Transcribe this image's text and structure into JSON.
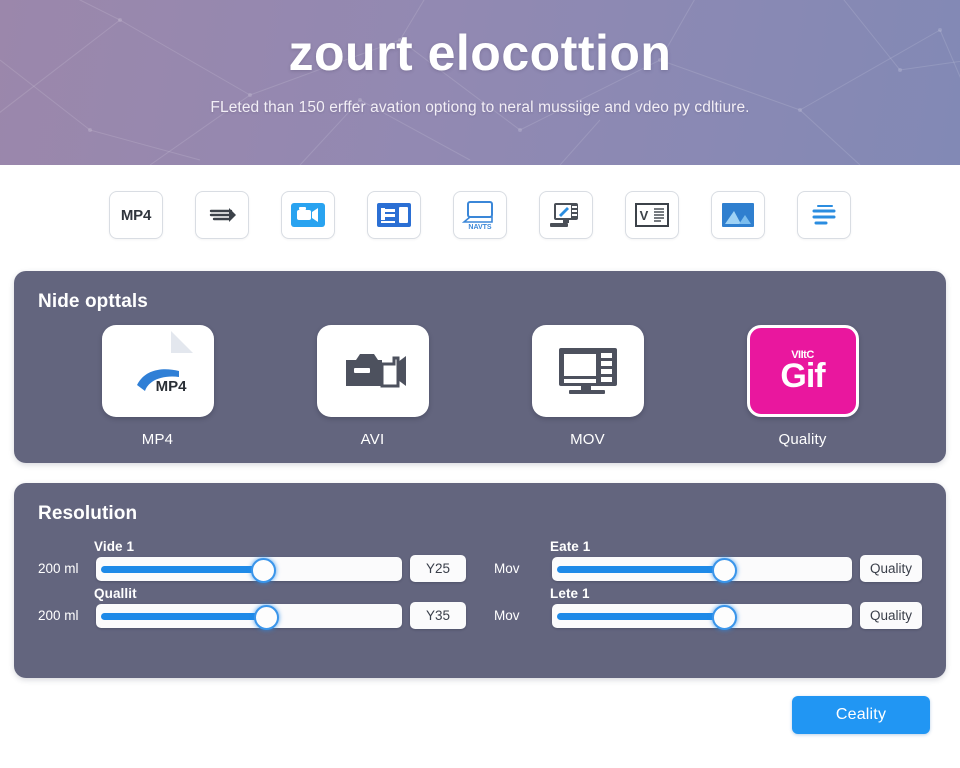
{
  "hero": {
    "title": "zourt elocottion",
    "subtitle": "FLeted than 150 erffer avation optiong to neral mussiige and vdeo py cdltiure."
  },
  "format_chips": [
    {
      "name": "mp4-text-icon",
      "label": "MP4",
      "kind": "text"
    },
    {
      "name": "audio-waves-icon",
      "label": "",
      "kind": "waves"
    },
    {
      "name": "video-camera-icon",
      "label": "",
      "kind": "camera"
    },
    {
      "name": "presentation-icon",
      "label": "",
      "kind": "slide"
    },
    {
      "name": "avi-window-icon",
      "label": "NAVTS",
      "kind": "window"
    },
    {
      "name": "desktop-edit-icon",
      "label": "",
      "kind": "desktop"
    },
    {
      "name": "document-book-icon",
      "label": "V",
      "kind": "book"
    },
    {
      "name": "image-photo-icon",
      "label": "",
      "kind": "photo"
    },
    {
      "name": "text-lines-icon",
      "label": "",
      "kind": "lines"
    }
  ],
  "formats_panel": {
    "title": "Nide opttals",
    "items": [
      {
        "label": "MP4",
        "glyph": "MP4",
        "icon": "mp4-file-icon",
        "highlight": false
      },
      {
        "label": "AVI",
        "glyph": "",
        "icon": "camcorder-icon",
        "highlight": false
      },
      {
        "label": "MOV",
        "glyph": "",
        "icon": "monitor-icon",
        "highlight": false
      },
      {
        "label": "Quality",
        "glyph": "Gif",
        "glyph_small": "VIItC",
        "icon": "gif-icon",
        "highlight": true
      }
    ]
  },
  "settings_panel": {
    "title": "Resolution",
    "sliders": [
      {
        "caption": "Vide 1",
        "left": "200 ml",
        "value": "Y25",
        "percent": 54
      },
      {
        "caption": "Eate 1",
        "left": "Mov",
        "value": "Quality",
        "percent": 57
      },
      {
        "caption": "Quallit",
        "left": "200 ml",
        "value": "Y35",
        "percent": 55
      },
      {
        "caption": "Lete 1",
        "left": "Mov",
        "value": "Quality",
        "percent": 57
      }
    ]
  },
  "footer": {
    "cta_label": "Ceality"
  },
  "colors": {
    "hero_left": "#9b87ab",
    "hero_right": "#8289b5",
    "panel": "#63657e",
    "slider_fill": "#1e8ae8",
    "accent": "#2196f3",
    "gif_magenta": "#e9179e"
  }
}
